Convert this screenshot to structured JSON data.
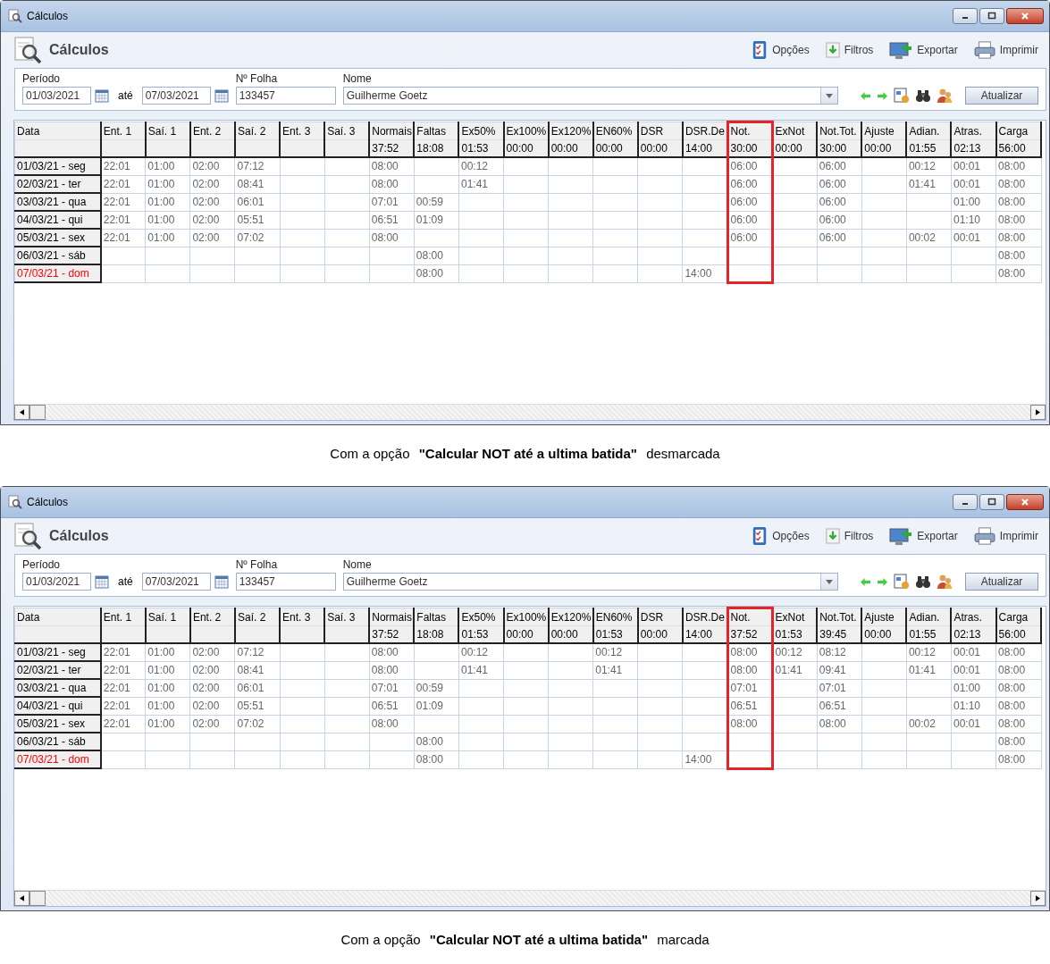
{
  "screens": [
    {
      "window": {
        "title": "Cálculos"
      },
      "heading": "Cálculos",
      "toolbar": [
        {
          "kind": "options",
          "label": "Opções"
        },
        {
          "kind": "filters",
          "label": "Filtros"
        },
        {
          "kind": "export",
          "label": "Exportar"
        },
        {
          "kind": "print",
          "label": "Imprimir"
        }
      ],
      "form": {
        "period_label": "Período",
        "date_from": "01/03/2021",
        "until_label": "até",
        "date_to": "07/03/2021",
        "sheet_label": "Nº Folha",
        "sheet_value": "133457",
        "name_label": "Nome",
        "name_value": "Guilherme Goetz",
        "refresh_button": "Atualizar"
      },
      "table": {
        "columns": [
          {
            "label": "Data",
            "highlighted": false
          },
          {
            "label": "Ent. 1",
            "highlighted": false
          },
          {
            "label": "Saí. 1",
            "highlighted": false
          },
          {
            "label": "Ent. 2",
            "highlighted": false
          },
          {
            "label": "Saí. 2",
            "highlighted": false
          },
          {
            "label": "Ent. 3",
            "highlighted": false
          },
          {
            "label": "Saí. 3",
            "highlighted": false
          },
          {
            "label": "Normais",
            "highlighted": false
          },
          {
            "label": "Faltas",
            "highlighted": false
          },
          {
            "label": "Ex50%",
            "highlighted": false
          },
          {
            "label": "Ex100%",
            "highlighted": false
          },
          {
            "label": "Ex120%",
            "highlighted": false
          },
          {
            "label": "EN60%",
            "highlighted": false
          },
          {
            "label": "DSR",
            "highlighted": false
          },
          {
            "label": "DSR.De",
            "highlighted": false
          },
          {
            "label": "Not.",
            "highlighted": true
          },
          {
            "label": "ExNot",
            "highlighted": false
          },
          {
            "label": "Not.Tot.",
            "highlighted": false
          },
          {
            "label": "Ajuste",
            "highlighted": false
          },
          {
            "label": "Adian.",
            "highlighted": false
          },
          {
            "label": "Atras.",
            "highlighted": false
          },
          {
            "label": "Carga",
            "highlighted": false
          }
        ],
        "totals": [
          "37:52",
          "18:08",
          "01:53",
          "00:00",
          "00:00",
          "00:00",
          "00:00",
          "14:00",
          "30:00",
          "00:00",
          "30:00",
          "00:00",
          "01:55",
          "02:13",
          "56:00"
        ],
        "rows": [
          {
            "color": "#000000",
            "cells": [
              "01/03/21 - seg",
              "22:01",
              "01:00",
              "02:00",
              "07:12",
              "",
              "",
              "08:00",
              "",
              "00:12",
              "",
              "",
              "",
              "",
              "",
              "06:00",
              "",
              "06:00",
              "",
              "00:12",
              "00:01",
              "08:00"
            ]
          },
          {
            "color": "#000000",
            "cells": [
              "02/03/21 - ter",
              "22:01",
              "01:00",
              "02:00",
              "08:41",
              "",
              "",
              "08:00",
              "",
              "01:41",
              "",
              "",
              "",
              "",
              "",
              "06:00",
              "",
              "06:00",
              "",
              "01:41",
              "00:01",
              "08:00"
            ]
          },
          {
            "color": "#000000",
            "cells": [
              "03/03/21 - qua",
              "22:01",
              "01:00",
              "02:00",
              "06:01",
              "",
              "",
              "07:01",
              "00:59",
              "",
              "",
              "",
              "",
              "",
              "",
              "06:00",
              "",
              "06:00",
              "",
              "",
              "01:00",
              "08:00"
            ]
          },
          {
            "color": "#000000",
            "cells": [
              "04/03/21 - qui",
              "22:01",
              "01:00",
              "02:00",
              "05:51",
              "",
              "",
              "06:51",
              "01:09",
              "",
              "",
              "",
              "",
              "",
              "",
              "06:00",
              "",
              "06:00",
              "",
              "",
              "01:10",
              "08:00"
            ]
          },
          {
            "color": "#000000",
            "cells": [
              "05/03/21 - sex",
              "22:01",
              "01:00",
              "02:00",
              "07:02",
              "",
              "",
              "08:00",
              "",
              "",
              "",
              "",
              "",
              "",
              "",
              "06:00",
              "",
              "06:00",
              "",
              "00:02",
              "00:01",
              "08:00"
            ]
          },
          {
            "color": "#000000",
            "cells": [
              "06/03/21 - sáb",
              "",
              "",
              "",
              "",
              "",
              "",
              "",
              "08:00",
              "",
              "",
              "",
              "",
              "",
              "",
              "",
              "",
              "",
              "",
              "",
              "",
              "08:00"
            ]
          },
          {
            "color": "#ff0000",
            "cells": [
              "07/03/21 - dom",
              "",
              "",
              "",
              "",
              "",
              "",
              "",
              "08:00",
              "",
              "",
              "",
              "",
              "",
              "14:00",
              "",
              "",
              "",
              "",
              "",
              "",
              "08:00"
            ]
          }
        ]
      },
      "caption": "Com a opção **\"Calcular NOT até a ultima batida\"** desmarcada"
    },
    {
      "window": {
        "title": "Cálculos"
      },
      "heading": "Cálculos",
      "toolbar": [
        {
          "kind": "options",
          "label": "Opções"
        },
        {
          "kind": "filters",
          "label": "Filtros"
        },
        {
          "kind": "export",
          "label": "Exportar"
        },
        {
          "kind": "print",
          "label": "Imprimir"
        }
      ],
      "form": {
        "period_label": "Período",
        "date_from": "01/03/2021",
        "until_label": "até",
        "date_to": "07/03/2021",
        "sheet_label": "Nº Folha",
        "sheet_value": "133457",
        "name_label": "Nome",
        "name_value": "Guilherme Goetz",
        "refresh_button": "Atualizar"
      },
      "table": {
        "columns": [
          {
            "label": "Data",
            "highlighted": false
          },
          {
            "label": "Ent. 1",
            "highlighted": false
          },
          {
            "label": "Saí. 1",
            "highlighted": false
          },
          {
            "label": "Ent. 2",
            "highlighted": false
          },
          {
            "label": "Saí. 2",
            "highlighted": false
          },
          {
            "label": "Ent. 3",
            "highlighted": false
          },
          {
            "label": "Saí. 3",
            "highlighted": false
          },
          {
            "label": "Normais",
            "highlighted": false
          },
          {
            "label": "Faltas",
            "highlighted": false
          },
          {
            "label": "Ex50%",
            "highlighted": false
          },
          {
            "label": "Ex100%",
            "highlighted": false
          },
          {
            "label": "Ex120%",
            "highlighted": false
          },
          {
            "label": "EN60%",
            "highlighted": false
          },
          {
            "label": "DSR",
            "highlighted": false
          },
          {
            "label": "DSR.De",
            "highlighted": false
          },
          {
            "label": "Not.",
            "highlighted": true
          },
          {
            "label": "ExNot",
            "highlighted": false
          },
          {
            "label": "Not.Tot.",
            "highlighted": false
          },
          {
            "label": "Ajuste",
            "highlighted": false
          },
          {
            "label": "Adian.",
            "highlighted": false
          },
          {
            "label": "Atras.",
            "highlighted": false
          },
          {
            "label": "Carga",
            "highlighted": false
          }
        ],
        "totals": [
          "37:52",
          "18:08",
          "01:53",
          "00:00",
          "00:00",
          "01:53",
          "00:00",
          "14:00",
          "37:52",
          "01:53",
          "39:45",
          "00:00",
          "01:55",
          "02:13",
          "56:00"
        ],
        "rows": [
          {
            "color": "#000000",
            "cells": [
              "01/03/21 - seg",
              "22:01",
              "01:00",
              "02:00",
              "07:12",
              "",
              "",
              "08:00",
              "",
              "00:12",
              "",
              "",
              "00:12",
              "",
              "",
              "08:00",
              "00:12",
              "08:12",
              "",
              "00:12",
              "00:01",
              "08:00"
            ]
          },
          {
            "color": "#000000",
            "cells": [
              "02/03/21 - ter",
              "22:01",
              "01:00",
              "02:00",
              "08:41",
              "",
              "",
              "08:00",
              "",
              "01:41",
              "",
              "",
              "01:41",
              "",
              "",
              "08:00",
              "01:41",
              "09:41",
              "",
              "01:41",
              "00:01",
              "08:00"
            ]
          },
          {
            "color": "#000000",
            "cells": [
              "03/03/21 - qua",
              "22:01",
              "01:00",
              "02:00",
              "06:01",
              "",
              "",
              "07:01",
              "00:59",
              "",
              "",
              "",
              "",
              "",
              "",
              "07:01",
              "",
              "07:01",
              "",
              "",
              "01:00",
              "08:00"
            ]
          },
          {
            "color": "#000000",
            "cells": [
              "04/03/21 - qui",
              "22:01",
              "01:00",
              "02:00",
              "05:51",
              "",
              "",
              "06:51",
              "01:09",
              "",
              "",
              "",
              "",
              "",
              "",
              "06:51",
              "",
              "06:51",
              "",
              "",
              "01:10",
              "08:00"
            ]
          },
          {
            "color": "#000000",
            "cells": [
              "05/03/21 - sex",
              "22:01",
              "01:00",
              "02:00",
              "07:02",
              "",
              "",
              "08:00",
              "",
              "",
              "",
              "",
              "",
              "",
              "",
              "08:00",
              "",
              "08:00",
              "",
              "00:02",
              "00:01",
              "08:00"
            ]
          },
          {
            "color": "#000000",
            "cells": [
              "06/03/21 - sáb",
              "",
              "",
              "",
              "",
              "",
              "",
              "",
              "08:00",
              "",
              "",
              "",
              "",
              "",
              "",
              "",
              "",
              "",
              "",
              "",
              "",
              "08:00"
            ]
          },
          {
            "color": "#ff0000",
            "cells": [
              "07/03/21 - dom",
              "",
              "",
              "",
              "",
              "",
              "",
              "",
              "08:00",
              "",
              "",
              "",
              "",
              "",
              "14:00",
              "",
              "",
              "",
              "",
              "",
              "",
              "08:00"
            ]
          }
        ]
      },
      "caption": "Com a opção **\"Calcular NOT até a ultima batida\"** marcada"
    }
  ]
}
